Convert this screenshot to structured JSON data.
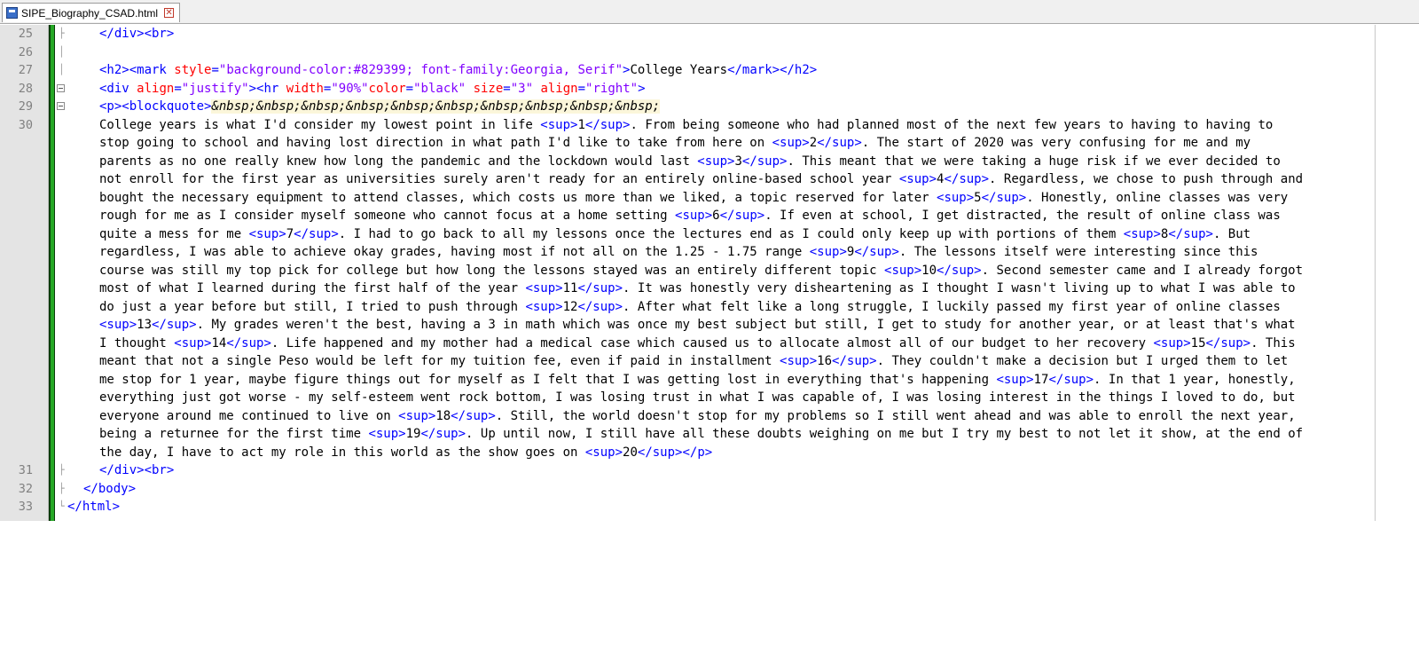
{
  "tab": {
    "filename": "SIPE_Biography_CSAD.html",
    "close_glyph": "✕"
  },
  "line_numbers": [
    "25",
    "26",
    "27",
    "28",
    "29",
    "30",
    "31",
    "32",
    "33"
  ],
  "lines": {
    "l25": {
      "t1": "</div><br>"
    },
    "l27": {
      "t1": "<h2><mark ",
      "a1": "style",
      "e1": "=",
      "v1": "\"background-color:#829399; font-family:Georgia, Serif\"",
      "t2": ">",
      "x1": "College Years",
      "t3": "</mark></h2>"
    },
    "l28": {
      "t1": "<div ",
      "a1": "align",
      "e1": "=",
      "v1": "\"justify\"",
      "t2": "><hr ",
      "a2": "width",
      "e2": "=",
      "v2": "\"90%\"",
      "a3": "color",
      "e3": "=",
      "v3": "\"black\"",
      "sp": " ",
      "a4": "size",
      "e4": "=",
      "v4": "\"3\"",
      "sp2": " ",
      "a5": "align",
      "e5": "=",
      "v5": "\"right\"",
      "t3": ">"
    },
    "l29": {
      "t1": "<p><blockquote>",
      "x1": "&nbsp;&nbsp;&nbsp;&nbsp;&nbsp;&nbsp;&nbsp;&nbsp;&nbsp;&nbsp;"
    },
    "l31": {
      "t1": "</div><br>"
    },
    "l32": {
      "t1": "</body>"
    },
    "l33": {
      "t1": "</html>"
    }
  },
  "paragraph_rows": [
    [
      [
        "College years is what I'd consider my lowest point in life ",
        0
      ],
      [
        "<sup>",
        1
      ],
      [
        "1",
        0
      ],
      [
        "</sup>",
        1
      ],
      [
        ". From being someone who had planned most of the next few years to having to having to",
        0
      ]
    ],
    [
      [
        "stop going to school and having lost direction in what path I'd like to take from here on ",
        0
      ],
      [
        "<sup>",
        1
      ],
      [
        "2",
        0
      ],
      [
        "</sup>",
        1
      ],
      [
        ". The start of 2020 was very confusing for me and my",
        0
      ]
    ],
    [
      [
        "parents as no one really knew how long the pandemic and the lockdown would last ",
        0
      ],
      [
        "<sup>",
        1
      ],
      [
        "3",
        0
      ],
      [
        "</sup>",
        1
      ],
      [
        ". This meant that we were taking a huge risk if we ever decided to",
        0
      ]
    ],
    [
      [
        "not enroll for the first year as universities surely aren't ready for an entirely online-based school year ",
        0
      ],
      [
        "<sup>",
        1
      ],
      [
        "4",
        0
      ],
      [
        "</sup>",
        1
      ],
      [
        ". Regardless, we chose to push through and",
        0
      ]
    ],
    [
      [
        "bought the necessary equipment to attend classes, which costs us more than we liked, a topic reserved for later ",
        0
      ],
      [
        "<sup>",
        1
      ],
      [
        "5",
        0
      ],
      [
        "</sup>",
        1
      ],
      [
        ". Honestly, online classes was very",
        0
      ]
    ],
    [
      [
        "rough for me as I consider myself someone who cannot focus at a home setting ",
        0
      ],
      [
        "<sup>",
        1
      ],
      [
        "6",
        0
      ],
      [
        "</sup>",
        1
      ],
      [
        ". If even at school, I get distracted, the result of online class was",
        0
      ]
    ],
    [
      [
        "quite a mess for me ",
        0
      ],
      [
        "<sup>",
        1
      ],
      [
        "7",
        0
      ],
      [
        "</sup>",
        1
      ],
      [
        ". I had to go back to all my lessons once the lectures end as I could only keep up with portions of them ",
        0
      ],
      [
        "<sup>",
        1
      ],
      [
        "8",
        0
      ],
      [
        "</sup>",
        1
      ],
      [
        ". But",
        0
      ]
    ],
    [
      [
        "regardless, I was able to achieve okay grades, having most if not all on the 1.25 - 1.75 range ",
        0
      ],
      [
        "<sup>",
        1
      ],
      [
        "9",
        0
      ],
      [
        "</sup>",
        1
      ],
      [
        ". The lessons itself were interesting since this",
        0
      ]
    ],
    [
      [
        "course was still my top pick for college but how long the lessons stayed was an entirely different topic ",
        0
      ],
      [
        "<sup>",
        1
      ],
      [
        "10",
        0
      ],
      [
        "</sup>",
        1
      ],
      [
        ". Second semester came and I already forgot",
        0
      ]
    ],
    [
      [
        "most of what I learned during the first half of the year ",
        0
      ],
      [
        "<sup>",
        1
      ],
      [
        "11",
        0
      ],
      [
        "</sup>",
        1
      ],
      [
        ". It was honestly very disheartening as I thought I wasn't living up to what I was able to",
        0
      ]
    ],
    [
      [
        "do just a year before but still, I tried to push through ",
        0
      ],
      [
        "<sup>",
        1
      ],
      [
        "12",
        0
      ],
      [
        "</sup>",
        1
      ],
      [
        ". After what felt like a long struggle, I luckily passed my first year of online classes",
        0
      ]
    ],
    [
      [
        "<sup>",
        1
      ],
      [
        "13",
        0
      ],
      [
        "</sup>",
        1
      ],
      [
        ". My grades weren't the best, having a 3 in math which was once my best subject but still, I get to study for another year, or at least that's what",
        0
      ]
    ],
    [
      [
        "I thought ",
        0
      ],
      [
        "<sup>",
        1
      ],
      [
        "14",
        0
      ],
      [
        "</sup>",
        1
      ],
      [
        ". Life happened and my mother had a medical case which caused us to allocate almost all of our budget to her recovery ",
        0
      ],
      [
        "<sup>",
        1
      ],
      [
        "15",
        0
      ],
      [
        "</sup>",
        1
      ],
      [
        ". This",
        0
      ]
    ],
    [
      [
        "meant that not a single Peso would be left for my tuition fee, even if paid in installment ",
        0
      ],
      [
        "<sup>",
        1
      ],
      [
        "16",
        0
      ],
      [
        "</sup>",
        1
      ],
      [
        ". They couldn't make a decision but I urged them to let",
        0
      ]
    ],
    [
      [
        "me stop for 1 year, maybe figure things out for myself as I felt that I was getting lost in everything that's happening ",
        0
      ],
      [
        "<sup>",
        1
      ],
      [
        "17",
        0
      ],
      [
        "</sup>",
        1
      ],
      [
        ". In that 1 year, honestly,",
        0
      ]
    ],
    [
      [
        "everything just got worse - my self-esteem went rock bottom, I was losing trust in what I was capable of, I was losing interest in the things I loved to do, but",
        0
      ]
    ],
    [
      [
        "everyone around me continued to live on ",
        0
      ],
      [
        "<sup>",
        1
      ],
      [
        "18",
        0
      ],
      [
        "</sup>",
        1
      ],
      [
        ". Still, the world doesn't stop for my problems so I still went ahead and was able to enroll the next year,",
        0
      ]
    ],
    [
      [
        "being a returnee for the first time ",
        0
      ],
      [
        "<sup>",
        1
      ],
      [
        "19",
        0
      ],
      [
        "</sup>",
        1
      ],
      [
        ". Up until now, I still have all these doubts weighing on me but I try my best to not let it show, at the end of",
        0
      ]
    ],
    [
      [
        "the day, I have to act my role in this world as the show goes on ",
        0
      ],
      [
        "<sup>",
        1
      ],
      [
        "20",
        0
      ],
      [
        "</sup></p>",
        1
      ]
    ]
  ]
}
